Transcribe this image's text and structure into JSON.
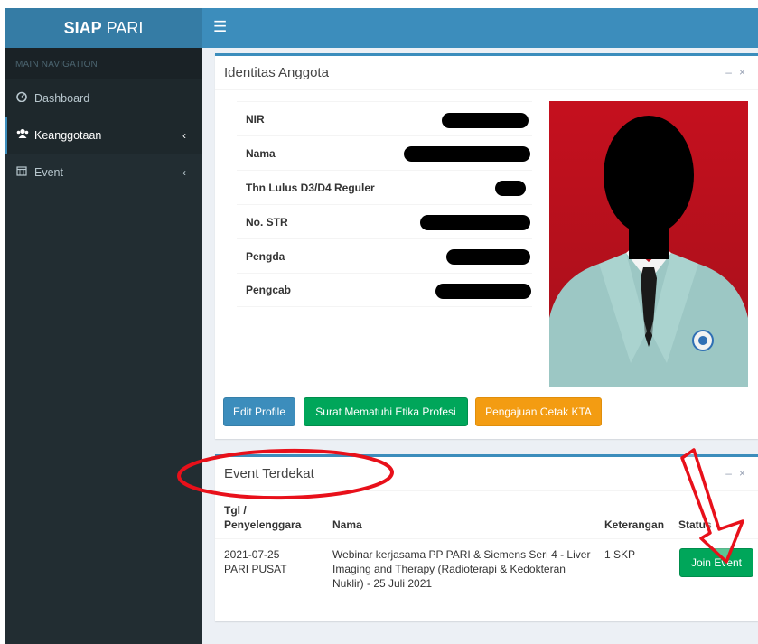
{
  "brand": {
    "bold": "SIAP",
    "rest": "PARI"
  },
  "navbar": {
    "toggle_icon": "bars-icon"
  },
  "sidebar": {
    "header": "MAIN NAVIGATION",
    "items": [
      {
        "label": "Dashboard",
        "icon": "dashboard-icon"
      },
      {
        "label": "Keanggotaan",
        "icon": "users-icon"
      },
      {
        "label": "Event",
        "icon": "calendar-icon"
      }
    ]
  },
  "identity": {
    "title": "Identitas Anggota",
    "fields": [
      "NIR",
      "Nama",
      "Thn Lulus D3/D4 Reguler",
      "No. STR",
      "Pengda",
      "Pengcab"
    ],
    "buttons": {
      "edit": "Edit Profile",
      "surat": "Surat Mematuhi Etika Profesi",
      "kta": "Pengajuan Cetak KTA"
    }
  },
  "events": {
    "title": "Event Terdekat",
    "columns": {
      "tgl_line1": "Tgl /",
      "tgl_line2": "Penyelenggara",
      "nama": "Nama",
      "keterangan": "Keterangan",
      "status": "Status"
    },
    "rows": [
      {
        "date": "2021-07-25",
        "organizer": "PARI PUSAT",
        "name_lines": [
          "Webinar kerjasama PP PARI & Siemens Seri 4 - Liver",
          "Imaging and Therapy (Radioterapi & Kedokteran",
          "Nuklir) - 25 Juli 2021"
        ],
        "keterangan": "1 SKP",
        "action": "Join Event"
      }
    ]
  },
  "colors": {
    "navbar": "#3c8dbc",
    "logo": "#357ca5",
    "sidebar": "#222d32",
    "annotation": "#e8101a"
  }
}
